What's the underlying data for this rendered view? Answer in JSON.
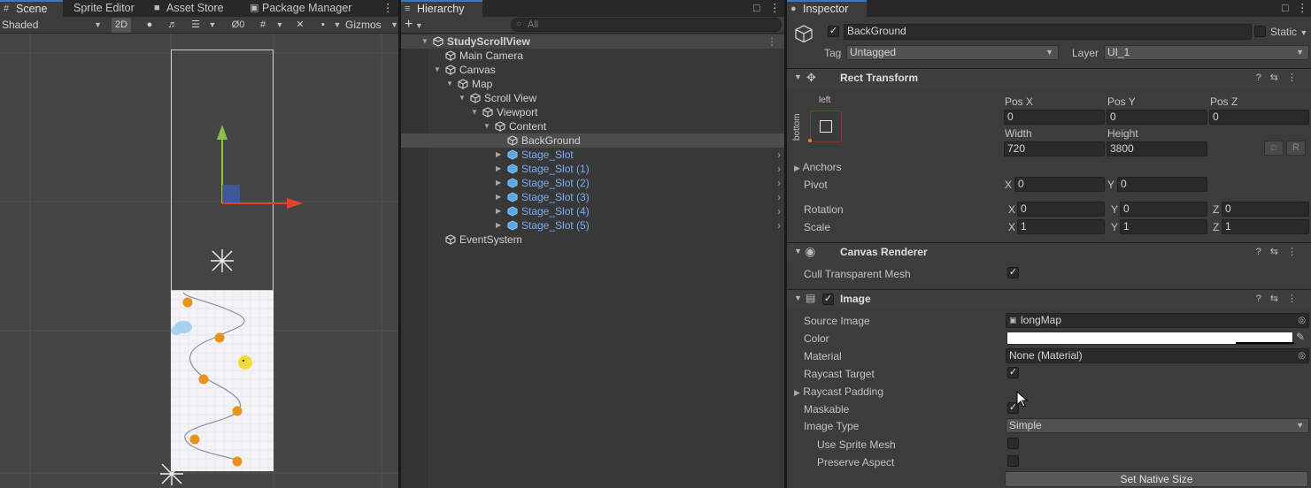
{
  "tabs_left": {
    "scene": "Scene",
    "sprite_editor": "Sprite Editor",
    "asset_store": "Asset Store",
    "package_manager": "Package Manager"
  },
  "tab_hierarchy": "Hierarchy",
  "tab_inspector": "Inspector",
  "scene_toolbar": {
    "shading_mode": "Shaded",
    "mode_2d": "2D",
    "hidden_count": "0",
    "gizmos": "Gizmos"
  },
  "hierarchy": {
    "add_label": "+",
    "search_placeholder": "All",
    "rows": [
      {
        "label": "StudyScrollView",
        "depth": 0,
        "expanded": true,
        "kind": "scene"
      },
      {
        "label": "Main Camera",
        "depth": 1,
        "expanded": null,
        "kind": "object"
      },
      {
        "label": "Canvas",
        "depth": 1,
        "expanded": true,
        "kind": "object"
      },
      {
        "label": "Map",
        "depth": 2,
        "expanded": true,
        "kind": "object"
      },
      {
        "label": "Scroll View",
        "depth": 3,
        "expanded": true,
        "kind": "object"
      },
      {
        "label": "Viewport",
        "depth": 4,
        "expanded": true,
        "kind": "object"
      },
      {
        "label": "Content",
        "depth": 5,
        "expanded": true,
        "kind": "object"
      },
      {
        "label": "BackGround",
        "depth": 6,
        "expanded": null,
        "kind": "object",
        "selected": true
      },
      {
        "label": "Stage_Slot",
        "depth": 6,
        "expanded": false,
        "kind": "prefab"
      },
      {
        "label": "Stage_Slot (1)",
        "depth": 6,
        "expanded": false,
        "kind": "prefab"
      },
      {
        "label": "Stage_Slot (2)",
        "depth": 6,
        "expanded": false,
        "kind": "prefab"
      },
      {
        "label": "Stage_Slot (3)",
        "depth": 6,
        "expanded": false,
        "kind": "prefab"
      },
      {
        "label": "Stage_Slot (4)",
        "depth": 6,
        "expanded": false,
        "kind": "prefab"
      },
      {
        "label": "Stage_Slot (5)",
        "depth": 6,
        "expanded": false,
        "kind": "prefab"
      },
      {
        "label": "EventSystem",
        "depth": 1,
        "expanded": null,
        "kind": "object"
      }
    ]
  },
  "inspector": {
    "object_name": "BackGround",
    "static_label": "Static",
    "tag_label": "Tag",
    "tag_value": "Untagged",
    "layer_label": "Layer",
    "layer_value": "UI_1",
    "rect_transform": {
      "title": "Rect Transform",
      "anchor_h": "left",
      "anchor_v": "bottom",
      "pos_x_label": "Pos X",
      "pos_y_label": "Pos Y",
      "pos_z_label": "Pos Z",
      "pos_x": "0",
      "pos_y": "0",
      "pos_z": "0",
      "width_label": "Width",
      "height_label": "Height",
      "width": "720",
      "height": "3800",
      "r_button": "R",
      "anchors_label": "Anchors",
      "pivot_label": "Pivot",
      "pivot_x": "0",
      "pivot_y": "0",
      "rotation_label": "Rotation",
      "rot_x": "0",
      "rot_y": "0",
      "rot_z": "0",
      "scale_label": "Scale",
      "scale_x": "1",
      "scale_y": "1",
      "scale_z": "1",
      "axis_x": "X",
      "axis_y": "Y",
      "axis_z": "Z"
    },
    "canvas_renderer": {
      "title": "Canvas Renderer",
      "cull_label": "Cull Transparent Mesh",
      "cull_checked": true
    },
    "image": {
      "title": "Image",
      "source_image_label": "Source Image",
      "source_image_value": "longMap",
      "color_label": "Color",
      "color_value": "#ffffff",
      "material_label": "Material",
      "material_value": "None (Material)",
      "raycast_target_label": "Raycast Target",
      "raycast_padding_label": "Raycast Padding",
      "maskable_label": "Maskable",
      "image_type_label": "Image Type",
      "image_type_value": "Simple",
      "use_sprite_mesh_label": "Use Sprite Mesh",
      "preserve_aspect_label": "Preserve Aspect",
      "set_native_size": "Set Native Size"
    }
  },
  "colors": {
    "accent": "#3a79bb",
    "selection": "#4d4d4d",
    "prefab": "#7cacf5",
    "dot": "#e8941a"
  }
}
